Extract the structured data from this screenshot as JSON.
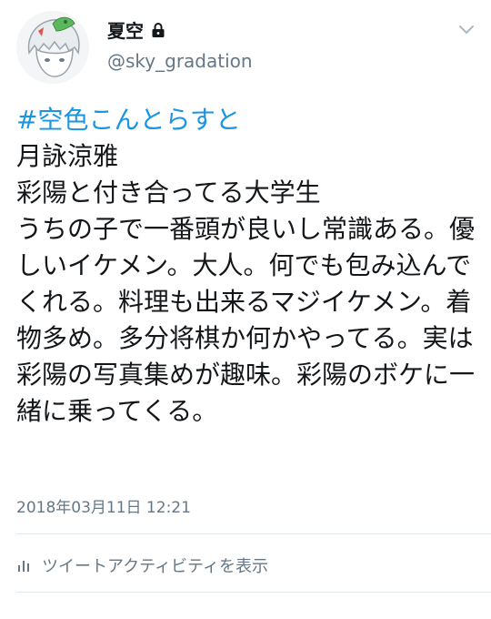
{
  "user": {
    "display_name": "夏空",
    "handle": "@sky_gradation",
    "avatar_icon": "user-avatar-image",
    "protected_icon": "lock-icon"
  },
  "tweet": {
    "hashtag": "#空色こんとらすと",
    "text": "\n月詠涼雅\n彩陽と付き合ってる大学生\nうちの子で一番頭が良いし常識ある。優しいイケメン。大人。何でも包み込んでくれる。料理も出来るマジイケメン。着物多め。多分将棋か何かやってる。実は彩陽の写真集めが趣味。彩陽のボケに一緒に乗ってくる。",
    "timestamp": "2018年03月11日 12:21"
  },
  "actions": {
    "activity_label": "ツイートアクティビティを表示",
    "activity_icon": "bar-chart-icon",
    "menu_icon": "chevron-down-icon"
  },
  "colors": {
    "hashtag": "#1b95e0",
    "secondary_text": "#657786",
    "divider": "#e1e8ed"
  }
}
